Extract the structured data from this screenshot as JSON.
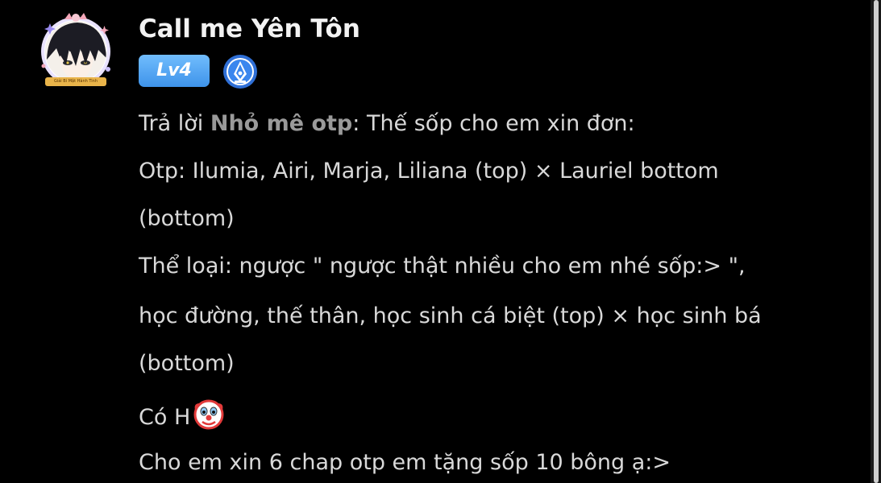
{
  "comment": {
    "username": "Call me Yên Tôn",
    "level": "Lv4",
    "badge_icon": "pen-nib-icon",
    "avatar_caption": "Giải Bí Mật Hành Tinh",
    "reply_prefix": "Trả lời ",
    "reply_to": "Nhỏ mê otp",
    "reply_suffix": ": Thế sốp cho em xin đơn:",
    "lines": [
      "Otp: Ilumia, Airi, Marja, Liliana (top) × Lauriel bottom",
      "(bottom)",
      "Thể loại: ngược \" ngược thật nhiều cho em nhé sốp:> \",",
      "học đường, thế thân, học sinh cá biệt (top) × học sinh bá",
      "(bottom)",
      "Có H",
      "Cho em xin 6 chap otp em tặng sốp 10 bông ạ:>"
    ],
    "emoji": "clown-face-emoji"
  },
  "colors": {
    "background": "#000000",
    "username": "#f2f2f2",
    "body_text": "#d9d9d9",
    "mention": "#9a9a9a",
    "level_badge": "#4fa3f5"
  }
}
